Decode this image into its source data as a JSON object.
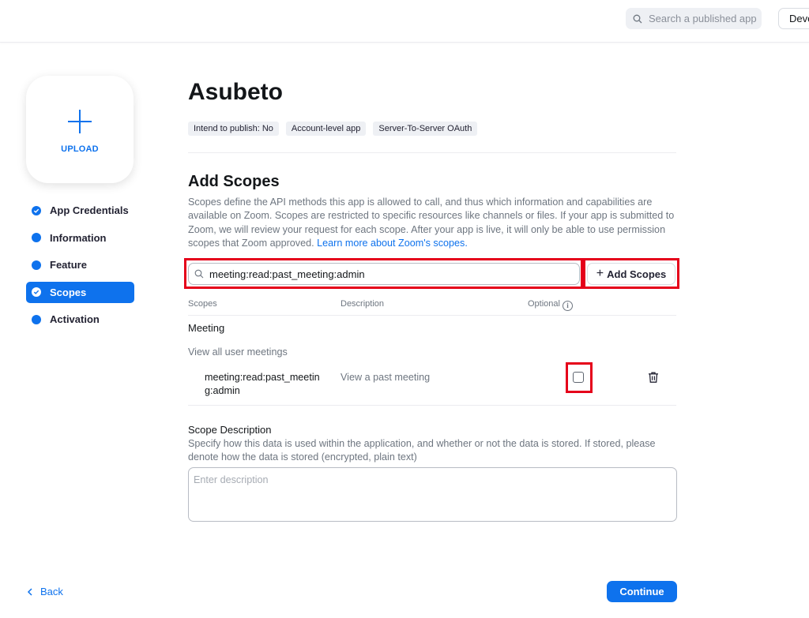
{
  "header": {
    "search_placeholder": "Search a published app",
    "dev_button_label": "Deve"
  },
  "upload": {
    "label": "UPLOAD"
  },
  "sidebar": {
    "items": [
      {
        "label": "App Credentials",
        "status": "completed"
      },
      {
        "label": "Information",
        "status": "pending"
      },
      {
        "label": "Feature",
        "status": "pending"
      },
      {
        "label": "Scopes",
        "status": "active"
      },
      {
        "label": "Activation",
        "status": "pending"
      }
    ]
  },
  "app": {
    "title": "Asubeto",
    "tags": [
      "Intend to publish: No",
      "Account-level app",
      "Server-To-Server OAuth"
    ]
  },
  "scopes_section": {
    "title": "Add Scopes",
    "description": "Scopes define the API methods this app is allowed to call, and thus which information and capabilities are available on Zoom. Scopes are restricted to specific resources like channels or files. If your app is submitted to Zoom, we will review your request for each scope. After your app is live, it will only be able to use permission scopes that Zoom approved.",
    "learn_more": "Learn more about Zoom's scopes.",
    "search_value": "meeting:read:past_meeting:admin",
    "add_button": "Add Scopes",
    "columns": {
      "scopes": "Scopes",
      "description": "Description",
      "optional": "Optional"
    },
    "group": {
      "title": "Meeting",
      "subtitle": "View all user meetings",
      "rows": [
        {
          "scope": "meeting:read:past_meeting:admin",
          "description": "View a past meeting",
          "optional": false
        }
      ]
    }
  },
  "scope_description": {
    "title": "Scope Description",
    "help": "Specify how this data is used within the application, and whether or not the data is stored. If stored, please denote how the data is stored (encrypted, plain text)",
    "placeholder": "Enter description"
  },
  "footer": {
    "back": "Back",
    "continue": "Continue"
  },
  "colors": {
    "accent": "#0e72ed",
    "highlight": "#e5001a"
  }
}
